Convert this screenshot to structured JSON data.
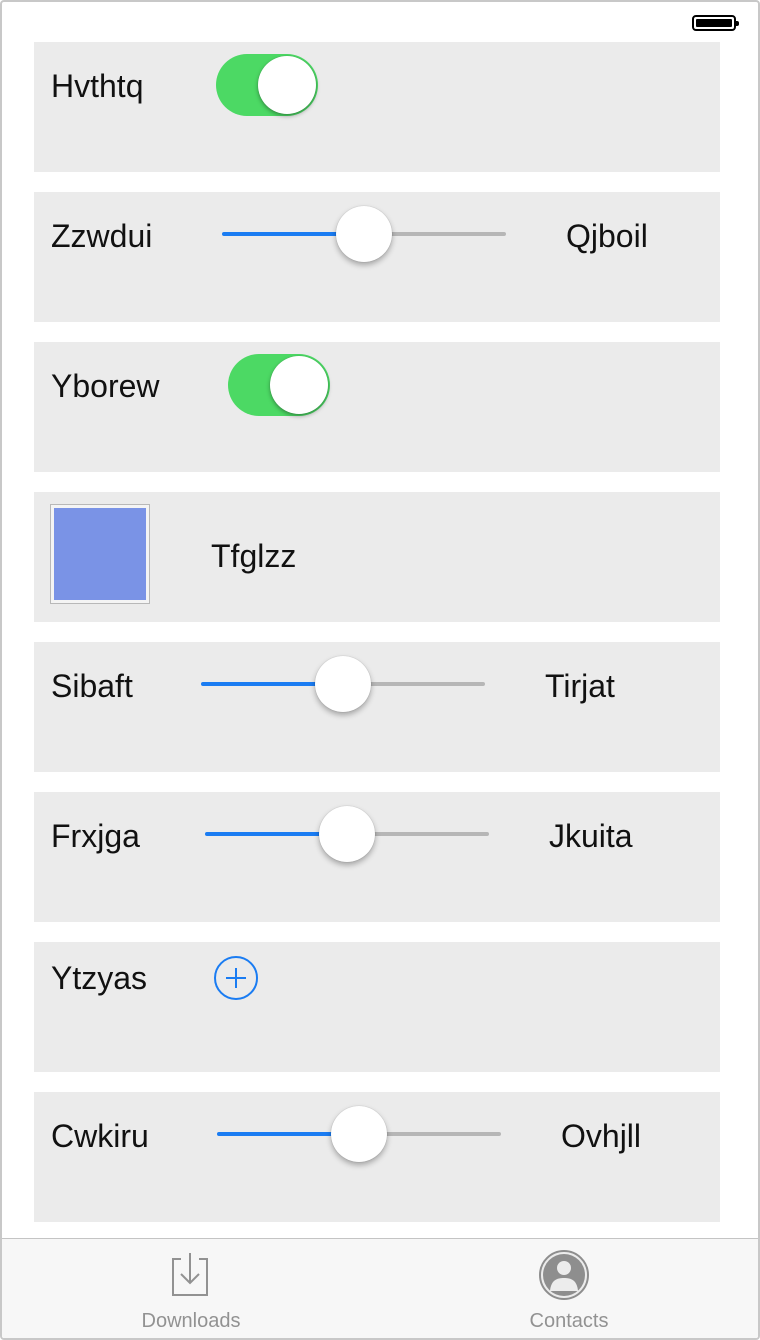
{
  "status_bar": {
    "battery_icon": "battery-full-icon"
  },
  "rows": [
    {
      "type": "toggle",
      "label": "Hvthtq",
      "on": true
    },
    {
      "type": "slider",
      "label": "Zzwdui",
      "value_label": "Qjboil",
      "value": 0.5
    },
    {
      "type": "toggle",
      "label": "Yborew",
      "on": true
    },
    {
      "type": "color",
      "label": "Tfglzz",
      "color": "#7a93e6"
    },
    {
      "type": "slider",
      "label": "Sibaft",
      "value_label": "Tirjat",
      "value": 0.5
    },
    {
      "type": "slider",
      "label": "Frxjga",
      "value_label": "Jkuita",
      "value": 0.5
    },
    {
      "type": "add",
      "label": "Ytzyas",
      "icon": "plus-circle-icon"
    },
    {
      "type": "slider",
      "label": "Cwkiru",
      "value_label": "Ovhjll",
      "value": 0.5
    }
  ],
  "tabbar": {
    "tabs": [
      {
        "label": "Downloads",
        "icon": "download-tray-icon"
      },
      {
        "label": "Contacts",
        "icon": "person-circle-icon"
      }
    ]
  },
  "colors": {
    "toggle_on": "#4cd964",
    "accent": "#1a7cf2",
    "row_background": "#ebebeb",
    "tab_inactive": "#929292"
  }
}
